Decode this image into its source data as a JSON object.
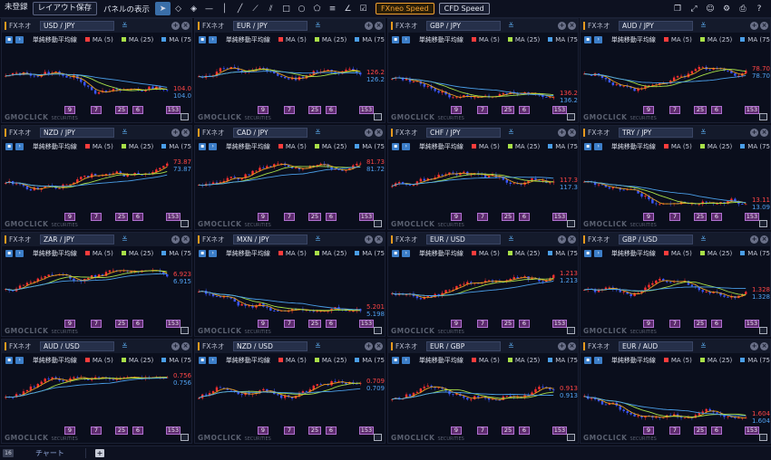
{
  "toolbar": {
    "unregistered": "未登録",
    "layout_save": "レイアウト保存",
    "panel_display": "パネルの表示",
    "fxneo_speed": "FXneo Speed",
    "cfd_speed": "CFD Speed"
  },
  "tool_icons": [
    "cursor-icon",
    "eraser-icon",
    "paint-bucket-icon",
    "horizontal-line-icon",
    "vertical-line-icon",
    "trend-line-icon",
    "ray-line-icon",
    "parallel-lines-icon",
    "rectangle-icon",
    "ellipse-icon",
    "polygon-icon",
    "fibonacci-icon",
    "angle-icon",
    "checkbox-icon"
  ],
  "right_icons": [
    "window-icon",
    "expand-icon",
    "user-icon",
    "gear-icon",
    "print-icon",
    "help-icon"
  ],
  "panel_common": {
    "label": "FXネオ",
    "indicator": "単純移動平均線",
    "ma5": "MA (5)",
    "ma25": "MA (25)",
    "ma75": "MA (75",
    "buttons": [
      "9",
      "7",
      "25",
      "6",
      "153"
    ],
    "watermark_main": "GMOCLICK",
    "watermark_sub": "SECURITIES"
  },
  "colors": {
    "ma5": "#ff3c3c",
    "ma25": "#e8a020",
    "ma75": "#a8e048",
    "ma200": "#4a9ee8",
    "up": "#ff3030",
    "down": "#3a56ff"
  },
  "panels": [
    {
      "symbol": "USD / JPY",
      "price1": "104.0",
      "price2": "104.0"
    },
    {
      "symbol": "EUR / JPY",
      "price1": "126.2",
      "price2": "126.2"
    },
    {
      "symbol": "GBP / JPY",
      "price1": "136.2",
      "price2": "136.2"
    },
    {
      "symbol": "AUD / JPY",
      "price1": "78.70",
      "price2": "78.70"
    },
    {
      "symbol": "NZD / JPY",
      "price1": "73.87",
      "price2": "73.87"
    },
    {
      "symbol": "CAD / JPY",
      "price1": "81.73",
      "price2": "81.72"
    },
    {
      "symbol": "CHF / JPY",
      "price1": "117.3",
      "price2": "117.3"
    },
    {
      "symbol": "TRY / JPY",
      "price1": "13.11",
      "price2": "13.09"
    },
    {
      "symbol": "ZAR / JPY",
      "price1": "6.923",
      "price2": "6.915"
    },
    {
      "symbol": "MXN / JPY",
      "price1": "5.201",
      "price2": "5.198"
    },
    {
      "symbol": "EUR / USD",
      "price1": "1.213",
      "price2": "1.213"
    },
    {
      "symbol": "GBP / USD",
      "price1": "1.328",
      "price2": "1.328"
    },
    {
      "symbol": "AUD / USD",
      "price1": "0.756",
      "price2": "0.756"
    },
    {
      "symbol": "NZD / USD",
      "price1": "0.709",
      "price2": "0.709"
    },
    {
      "symbol": "EUR / GBP",
      "price1": "0.913",
      "price2": "0.913"
    },
    {
      "symbol": "EUR / AUD",
      "price1": "1.604",
      "price2": "1.604"
    }
  ],
  "footer": {
    "count": "16",
    "tab": "チャート"
  }
}
